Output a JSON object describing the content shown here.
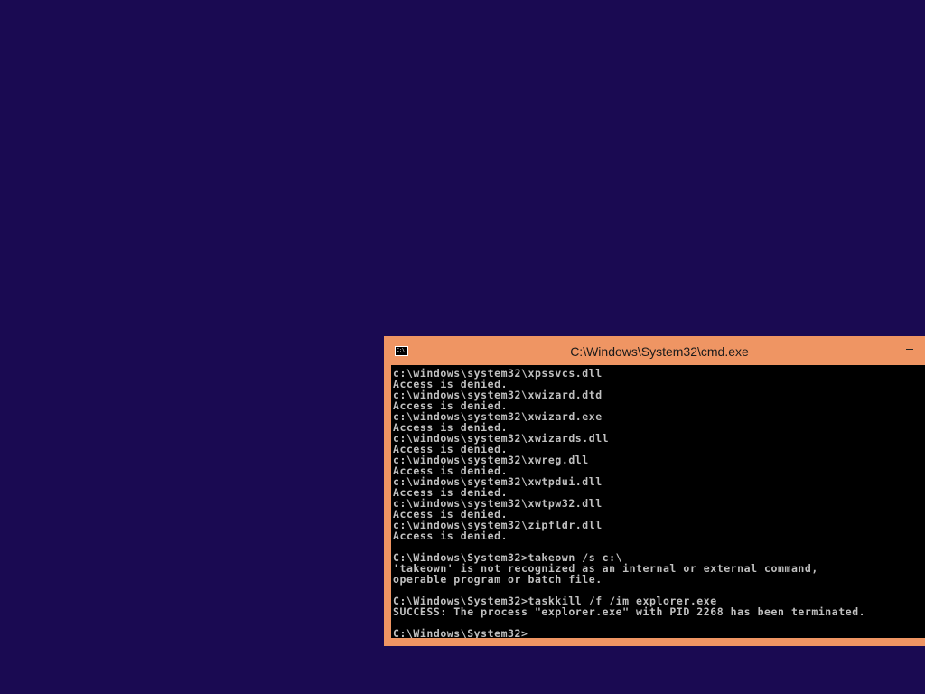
{
  "window": {
    "title": "C:\\Windows\\System32\\cmd.exe",
    "icon_name": "cmd-icon",
    "icon_text": "C:\\",
    "title_bar_color": "#ef9563"
  },
  "desktop": {
    "background_color": "#1a0a52"
  },
  "console": {
    "background_color": "#000000",
    "text_color": "#c0c0c0",
    "lines": [
      "c:\\windows\\system32\\xpssvcs.dll",
      "Access is denied.",
      "c:\\windows\\system32\\xwizard.dtd",
      "Access is denied.",
      "c:\\windows\\system32\\xwizard.exe",
      "Access is denied.",
      "c:\\windows\\system32\\xwizards.dll",
      "Access is denied.",
      "c:\\windows\\system32\\xwreg.dll",
      "Access is denied.",
      "c:\\windows\\system32\\xwtpdui.dll",
      "Access is denied.",
      "c:\\windows\\system32\\xwtpw32.dll",
      "Access is denied.",
      "c:\\windows\\system32\\zipfldr.dll",
      "Access is denied.",
      "",
      "C:\\Windows\\System32>takeown /s c:\\",
      "'takeown' is not recognized as an internal or external command,",
      "operable program or batch file.",
      "",
      "C:\\Windows\\System32>taskkill /f /im explorer.exe",
      "SUCCESS: The process \"explorer.exe\" with PID 2268 has been terminated.",
      "",
      "C:\\Windows\\System32>"
    ]
  }
}
